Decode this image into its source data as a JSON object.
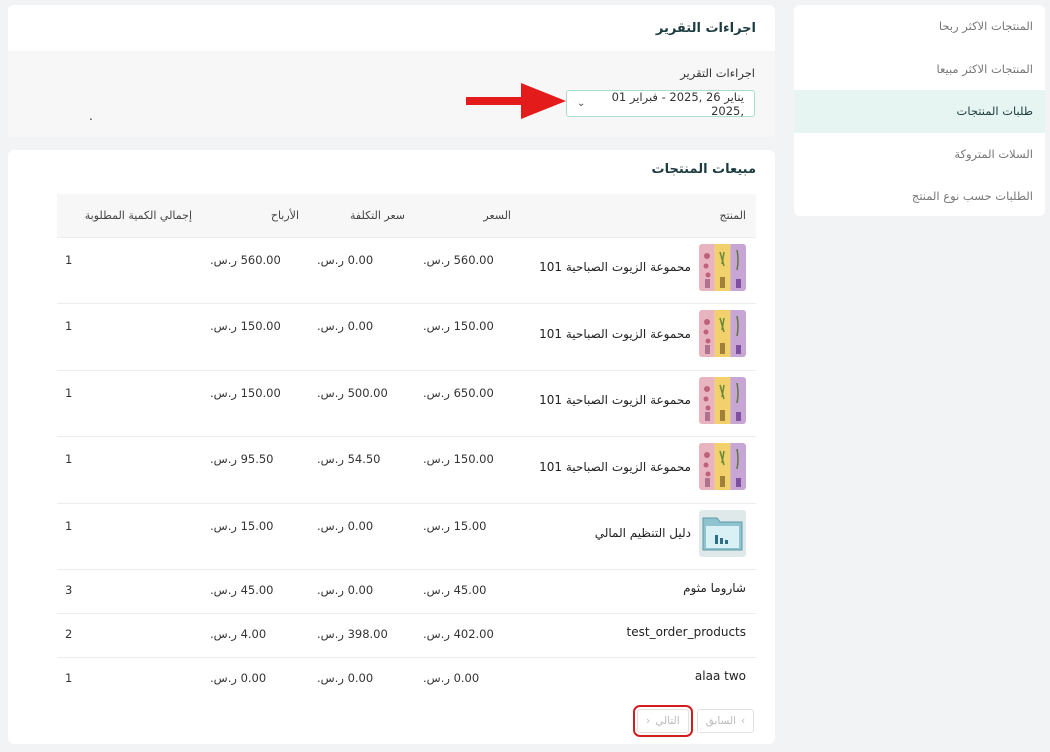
{
  "sidebar": {
    "items": [
      {
        "label": "المنتجات الاكثر ربحا"
      },
      {
        "label": "المنتجات الاكثر مبيعا"
      },
      {
        "label": "طلبات المنتجات"
      },
      {
        "label": "السلات المتروكة"
      },
      {
        "label": "الطلبات حسب نوع المنتج"
      }
    ],
    "active_index": 2
  },
  "report": {
    "title": "اجراءات التقرير",
    "field_label": "اجراءات التقرير",
    "date_range": "يناير 26 ,2025 - فبراير 01 ,2025",
    "dot": "."
  },
  "sales": {
    "title": "مبيعات المنتجات",
    "headers": {
      "product": "المنتج",
      "price": "السعر",
      "cost": "سعر التكلفة",
      "profit": "الأرباح",
      "quantity": "إجمالي الكمية المطلوبة"
    },
    "rows": [
      {
        "name": "محموعة الزيوت الصباحية 101",
        "price": "560.00 ر.س.",
        "cost": "0.00 ر.س.",
        "profit": "560.00 ر.س.",
        "qty": "1",
        "thumb": "oils-icon"
      },
      {
        "name": "محموعة الزيوت الصباحية 101",
        "price": "150.00 ر.س.",
        "cost": "0.00 ر.س.",
        "profit": "150.00 ر.س.",
        "qty": "1",
        "thumb": "oils-icon"
      },
      {
        "name": "محموعة الزيوت الصباحية 101",
        "price": "650.00 ر.س.",
        "cost": "500.00 ر.س.",
        "profit": "150.00 ر.س.",
        "qty": "1",
        "thumb": "oils-icon"
      },
      {
        "name": "محموعة الزيوت الصباحية 101",
        "price": "150.00 ر.س.",
        "cost": "54.50 ر.س.",
        "profit": "95.50 ر.س.",
        "qty": "1",
        "thumb": "oils-icon"
      },
      {
        "name": "دليل التنظيم المالي",
        "price": "15.00 ر.س.",
        "cost": "0.00 ر.س.",
        "profit": "15.00 ر.س.",
        "qty": "1",
        "thumb": "finance-folder-icon"
      },
      {
        "name": "شاروما مثوم",
        "price": "45.00 ر.س.",
        "cost": "0.00 ر.س.",
        "profit": "45.00 ر.س.",
        "qty": "3"
      },
      {
        "name": "test_order_products",
        "price": "402.00 ر.س.",
        "cost": "398.00 ر.س.",
        "profit": "4.00 ر.س.",
        "qty": "2"
      },
      {
        "name": "alaa two",
        "price": "0.00 ر.س.",
        "cost": "0.00 ر.س.",
        "profit": "0.00 ر.س.",
        "qty": "1"
      }
    ],
    "pagination": {
      "prev": "السابق",
      "next": "التالي"
    }
  },
  "colors": {
    "accent": "#1d3c40",
    "active_bg": "#e6f5f1",
    "highlight": "#d01f1f",
    "arrow": "#e31b1b"
  }
}
